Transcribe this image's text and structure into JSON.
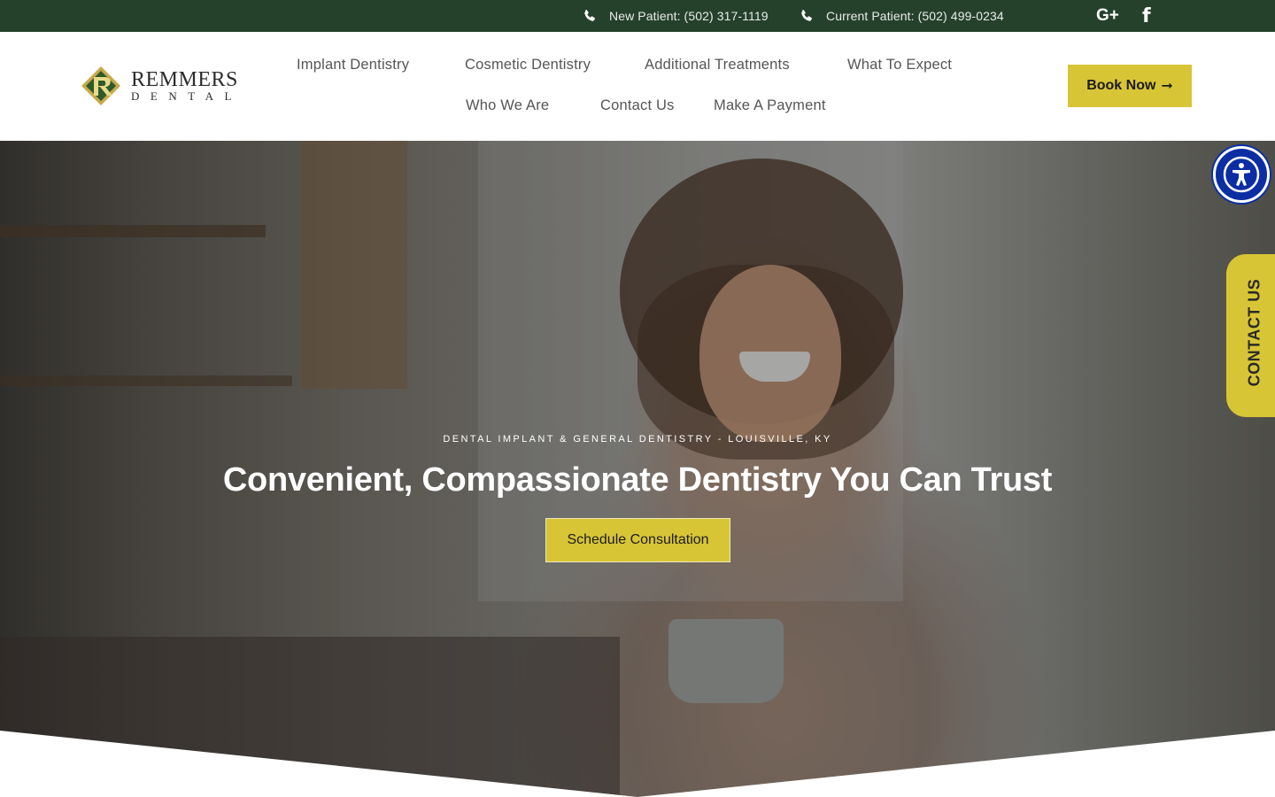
{
  "topbar": {
    "new_patient": "New Patient: (502) 317-1119",
    "current_patient": "Current Patient: (502) 499-0234",
    "google_icon_text": "G+",
    "facebook_icon_text": "f",
    "icons": [
      "phone-icon",
      "phone-icon",
      "google-plus-icon",
      "facebook-icon"
    ]
  },
  "logo": {
    "line1": "REMMERS",
    "line2": "DENTAL"
  },
  "nav": {
    "items": [
      "Implant Dentistry",
      "Cosmetic Dentistry",
      "Additional Treatments",
      "What To Expect",
      "Who We Are",
      "Contact Us",
      "Make A Payment"
    ]
  },
  "book_button": {
    "label": "Book Now",
    "arrow": "➞"
  },
  "hero": {
    "kicker": "DENTAL IMPLANT & GENERAL DENTISTRY - LOUISVILLE, KY",
    "title": "Convenient, Compassionate Dentistry You Can Trust",
    "cta": "Schedule Consultation"
  },
  "side": {
    "contact_tab": "CONTACT US",
    "accessibility_icon": "accessibility-icon"
  },
  "colors": {
    "topbar": "#25412c",
    "accent": "#d8c536",
    "accessibility": "#0b2ea3"
  }
}
